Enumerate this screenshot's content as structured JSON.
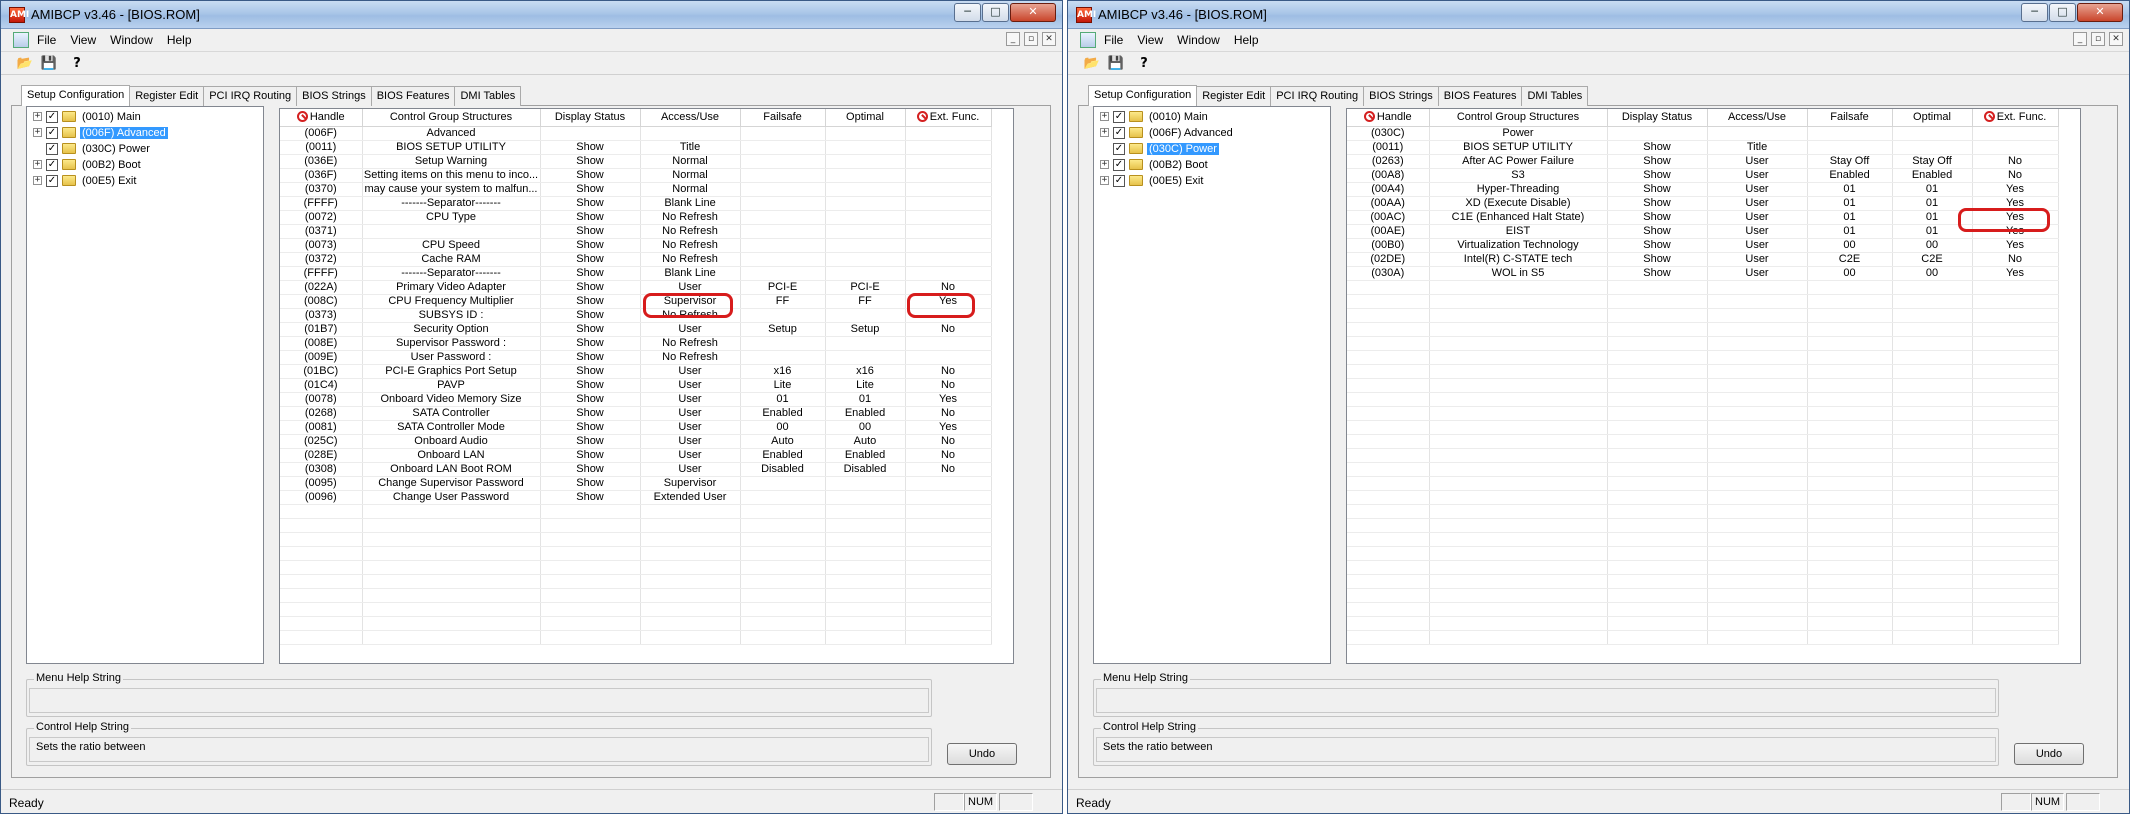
{
  "app": {
    "title": "AMIBCP v3.46 - [BIOS.ROM]",
    "app_icon_text": "AMI",
    "window_buttons": {
      "minimize": "─",
      "maximize": "□",
      "close": "✕"
    },
    "menu": [
      "File",
      "View",
      "Window",
      "Help"
    ],
    "mdi_buttons": {
      "minimize": "_",
      "restore": "▫",
      "close": "✕"
    },
    "toolbar": {
      "open_icon": "folder-open-icon",
      "save_icon": "floppy-disk-icon",
      "help_icon": "context-help-icon"
    },
    "tabs": [
      "Setup Configuration",
      "Register Edit",
      "PCI IRQ Routing",
      "BIOS Strings",
      "BIOS Features",
      "DMI Tables"
    ],
    "columns": [
      "Handle",
      "Control Group Structures",
      "Display Status",
      "Access/Use",
      "Failsafe",
      "Optimal",
      "Ext. Func."
    ],
    "menu_help_label": "Menu Help String",
    "menu_help_text": "",
    "control_help_label": "Control Help String",
    "control_help_text": "Sets the ratio between",
    "undo_label": "Undo",
    "status": {
      "ready": "Ready",
      "num": "NUM"
    },
    "colors": {
      "highlight": "#d71c1c",
      "selection": "#3399ff"
    }
  },
  "left": {
    "tree": [
      {
        "label": "(0010) Main",
        "expander": "+",
        "selected": false
      },
      {
        "label": "(006F) Advanced",
        "expander": "+",
        "selected": true
      },
      {
        "label": "(030C) Power",
        "expander": "",
        "selected": false
      },
      {
        "label": "(00B2) Boot",
        "expander": "+",
        "selected": false
      },
      {
        "label": "(00E5) Exit",
        "expander": "+",
        "selected": false
      }
    ],
    "rows": [
      [
        "(006F)",
        "Advanced",
        "",
        "",
        "",
        "",
        ""
      ],
      [
        "(0011)",
        "BIOS SETUP UTILITY",
        "Show",
        "Title",
        "",
        "",
        ""
      ],
      [
        "(036E)",
        "Setup Warning",
        "Show",
        "Normal",
        "",
        "",
        ""
      ],
      [
        "(036F)",
        "Setting items on this menu to inco...",
        "Show",
        "Normal",
        "",
        "",
        ""
      ],
      [
        "(0370)",
        "may cause your system to malfun...",
        "Show",
        "Normal",
        "",
        "",
        ""
      ],
      [
        "(FFFF)",
        "-------Separator-------",
        "Show",
        "Blank Line",
        "",
        "",
        ""
      ],
      [
        "(0072)",
        "CPU Type",
        "Show",
        "No Refresh",
        "",
        "",
        ""
      ],
      [
        "(0371)",
        "",
        "Show",
        "No Refresh",
        "",
        "",
        ""
      ],
      [
        "(0073)",
        "CPU Speed",
        "Show",
        "No Refresh",
        "",
        "",
        ""
      ],
      [
        "(0372)",
        "Cache RAM",
        "Show",
        "No Refresh",
        "",
        "",
        ""
      ],
      [
        "(FFFF)",
        "-------Separator-------",
        "Show",
        "Blank Line",
        "",
        "",
        ""
      ],
      [
        "(022A)",
        "Primary Video Adapter",
        "Show",
        "User",
        "PCI-E",
        "PCI-E",
        "No"
      ],
      [
        "(008C)",
        "CPU Frequency Multiplier",
        "Show",
        "Supervisor",
        "FF",
        "FF",
        "Yes"
      ],
      [
        "(0373)",
        "SUBSYS ID              :",
        "Show",
        "No Refresh",
        "",
        "",
        ""
      ],
      [
        "(01B7)",
        "Security Option",
        "Show",
        "User",
        "Setup",
        "Setup",
        "No"
      ],
      [
        "(008E)",
        "Supervisor Password          :",
        "Show",
        "No Refresh",
        "",
        "",
        ""
      ],
      [
        "(009E)",
        "User Password              :",
        "Show",
        "No Refresh",
        "",
        "",
        ""
      ],
      [
        "(01BC)",
        "PCI-E Graphics Port Setup",
        "Show",
        "User",
        "x16",
        "x16",
        "No"
      ],
      [
        "(01C4)",
        "PAVP",
        "Show",
        "User",
        "Lite",
        "Lite",
        "No"
      ],
      [
        "(0078)",
        "Onboard Video Memory Size",
        "Show",
        "User",
        "01",
        "01",
        "Yes"
      ],
      [
        "(0268)",
        "SATA Controller",
        "Show",
        "User",
        "Enabled",
        "Enabled",
        "No"
      ],
      [
        "(0081)",
        "SATA Controller Mode",
        "Show",
        "User",
        "00",
        "00",
        "Yes"
      ],
      [
        "(025C)",
        "Onboard Audio",
        "Show",
        "User",
        "Auto",
        "Auto",
        "No"
      ],
      [
        "(028E)",
        "Onboard LAN",
        "Show",
        "User",
        "Enabled",
        "Enabled",
        "No"
      ],
      [
        "(0308)",
        "Onboard LAN Boot ROM",
        "Show",
        "User",
        "Disabled",
        "Disabled",
        "No"
      ],
      [
        "(0095)",
        "Change Supervisor Password",
        "Show",
        "Supervisor",
        "",
        "",
        ""
      ],
      [
        "(0096)",
        "Change User Password",
        "Show",
        "Extended User",
        "",
        "",
        ""
      ]
    ]
  },
  "right": {
    "tree": [
      {
        "label": "(0010) Main",
        "expander": "+",
        "selected": false
      },
      {
        "label": "(006F) Advanced",
        "expander": "+",
        "selected": false
      },
      {
        "label": "(030C) Power",
        "expander": "",
        "selected": true
      },
      {
        "label": "(00B2) Boot",
        "expander": "+",
        "selected": false
      },
      {
        "label": "(00E5) Exit",
        "expander": "+",
        "selected": false
      }
    ],
    "rows": [
      [
        "(030C)",
        "Power",
        "",
        "",
        "",
        "",
        ""
      ],
      [
        "(0011)",
        "BIOS SETUP UTILITY",
        "Show",
        "Title",
        "",
        "",
        ""
      ],
      [
        "(0263)",
        "After AC Power Failure",
        "Show",
        "User",
        "Stay Off",
        "Stay Off",
        "No"
      ],
      [
        "(00A8)",
        "S3",
        "Show",
        "User",
        "Enabled",
        "Enabled",
        "No"
      ],
      [
        "(00A4)",
        "Hyper-Threading",
        "Show",
        "User",
        "01",
        "01",
        "Yes"
      ],
      [
        "(00AA)",
        "XD (Execute Disable)",
        "Show",
        "User",
        "01",
        "01",
        "Yes"
      ],
      [
        "(00AC)",
        "C1E (Enhanced Halt State)",
        "Show",
        "User",
        "01",
        "01",
        "Yes"
      ],
      [
        "(00AE)",
        "EIST",
        "Show",
        "User",
        "01",
        "01",
        "Yes"
      ],
      [
        "(00B0)",
        "Virtualization Technology",
        "Show",
        "User",
        "00",
        "00",
        "Yes"
      ],
      [
        "(02DE)",
        "Intel(R) C-STATE tech",
        "Show",
        "User",
        "C2E",
        "C2E",
        "No"
      ],
      [
        "(030A)",
        "WOL in S5",
        "Show",
        "User",
        "00",
        "00",
        "Yes"
      ]
    ]
  }
}
